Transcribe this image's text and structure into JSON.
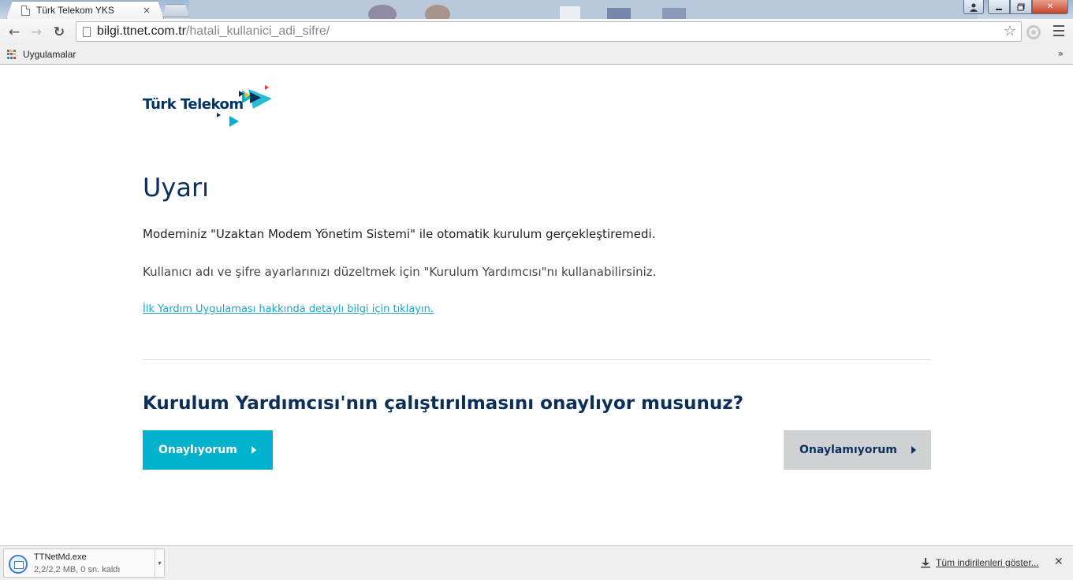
{
  "browser": {
    "tab_title": "Türk Telekom YKS",
    "tab_close": "×",
    "url_host": "bilgi.ttnet.com.tr",
    "url_path": "/hatali_kullanici_adi_sifre/",
    "star_glyph": "☆",
    "bookmarks_label": "Uygulamalar",
    "bookmarks_overflow": "»",
    "nav": {
      "back": "←",
      "forward": "→",
      "reload": "↻"
    },
    "window": {
      "minimize": "—",
      "maximize": "▫",
      "close": "✕",
      "user": "👤"
    }
  },
  "page": {
    "logo_text": "Türk Telekom",
    "heading": "Uyarı",
    "message_1": "Modeminiz \"Uzaktan Modem Yönetim Sistemi\" ile otomatik kurulum gerçekleştiremedi.",
    "message_2": "Kullanıcı adı ve şifre ayarlarınızı düzeltmek için \"Kurulum Yardımcısı\"nı kullanabilirsiniz.",
    "help_link": "İlk Yardım Uygulaması hakkında detaylı bilgi için tıklayın.",
    "question": "Kurulum Yardımcısı'nın çalıştırılmasını onaylıyor musunuz?",
    "confirm_button": "Onaylıyorum",
    "decline_button": "Onaylamıyorum",
    "colors": {
      "primary": "#00b2cd",
      "navy": "#0b2f5a",
      "secondary": "#cfd1d4"
    }
  },
  "downloads": {
    "file_name": "TTNetMd.exe",
    "file_status": "2,2/2,2 MB, 0 sn. kaldı",
    "menu_glyph": "▾",
    "show_all": "Tüm indirilenleri göster...",
    "close_glyph": "✕"
  }
}
